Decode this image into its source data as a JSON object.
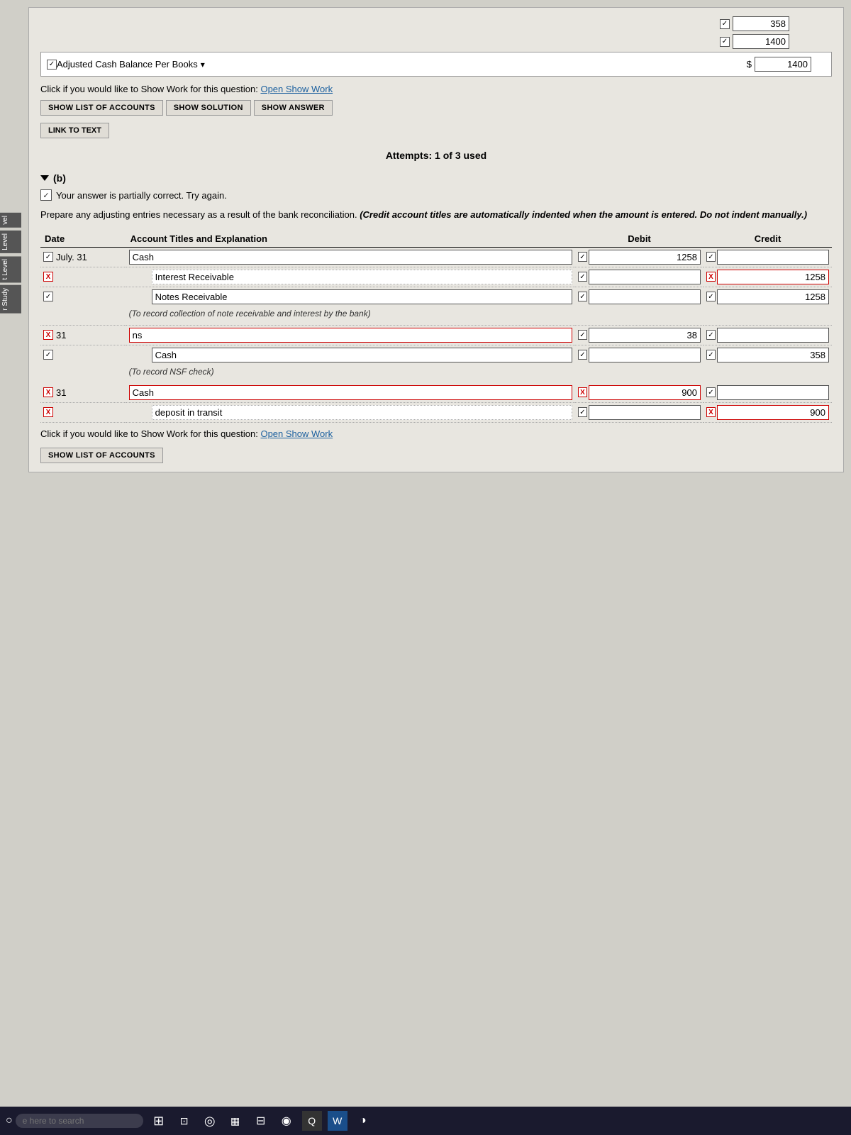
{
  "page": {
    "background": "#1a1a1a",
    "main_bg": "#e8e6e0"
  },
  "top": {
    "value1": "358",
    "value2": "1400",
    "dropdown_label": "Adjusted Cash Balance Per Books",
    "dropdown_arrow": "▾",
    "dollar_sign": "$",
    "show_work_label": "Click if you would like to Show Work for this question:",
    "open_show_work": "Open Show Work"
  },
  "buttons": {
    "show_list": "SHOW LIST OF ACCOUNTS",
    "show_solution": "SHOW SOLUTION",
    "show_answer": "SHOW ANSWER",
    "link_to_text": "LINK TO TEXT"
  },
  "attempts": {
    "text": "Attempts: 1 of 3 used"
  },
  "section_b": {
    "label": "(b)",
    "partial_text": "Your answer is partially correct.  Try again.",
    "instruction": "Prepare any adjusting entries necessary as a result of the bank reconciliation.",
    "instruction_italic": "(Credit account titles are automatically indented when the amount is entered. Do not indent manually.)",
    "table_headers": {
      "date": "Date",
      "account": "Account Titles and Explanation",
      "debit": "Debit",
      "credit": "Credit"
    },
    "entries": [
      {
        "id": "entry1",
        "rows": [
          {
            "date": "July. 31",
            "account": "Cash",
            "debit": "1258",
            "credit": "",
            "marker": "check",
            "debit_marker": "check",
            "credit_marker": "check",
            "indent": 0
          },
          {
            "date": "",
            "account": "Interest Receivable",
            "debit": "",
            "credit": "1258",
            "marker": "x",
            "debit_marker": "check",
            "credit_marker": "none",
            "indent": 1,
            "credit_red": true
          },
          {
            "date": "",
            "account": "Notes Receivable",
            "debit": "",
            "credit": "1258",
            "marker": "check",
            "debit_marker": "check",
            "credit_marker": "check",
            "indent": 1
          }
        ],
        "memo": "(To record collection of note receivable and interest by the bank)"
      },
      {
        "id": "entry2",
        "rows": [
          {
            "date": "31",
            "account": "ns",
            "debit": "38",
            "credit": "",
            "marker": "x",
            "debit_marker": "check",
            "credit_marker": "check",
            "indent": 0
          },
          {
            "date": "",
            "account": "Cash",
            "debit": "",
            "credit": "358",
            "marker": "check",
            "debit_marker": "check",
            "credit_marker": "check",
            "indent": 1
          }
        ],
        "memo": "(To record NSF check)"
      },
      {
        "id": "entry3",
        "rows": [
          {
            "date": "31",
            "account": "Cash",
            "debit": "900",
            "credit": "",
            "marker": "x",
            "debit_marker": "x",
            "credit_marker": "check",
            "indent": 0
          },
          {
            "date": "",
            "account": "deposit in transit",
            "debit": "",
            "credit": "900",
            "marker": "x",
            "debit_marker": "check",
            "credit_marker": "x",
            "indent": 1
          }
        ],
        "memo": ""
      }
    ],
    "bottom_show_work": "Click if you would like to Show Work for this question:",
    "bottom_open_show_work": "Open Show Work",
    "show_list_accounts": "SHOW LIST OF ACCOUNTS"
  },
  "sidebar": {
    "items": [
      "vel",
      "Level",
      "t Level",
      "r Study"
    ]
  },
  "taskbar": {
    "search_placeholder": "e here to search",
    "icons": [
      "⊞",
      "⊡",
      "◎",
      "▦",
      "⊟",
      "◈",
      "◑",
      "Q",
      "W",
      "◉"
    ]
  }
}
